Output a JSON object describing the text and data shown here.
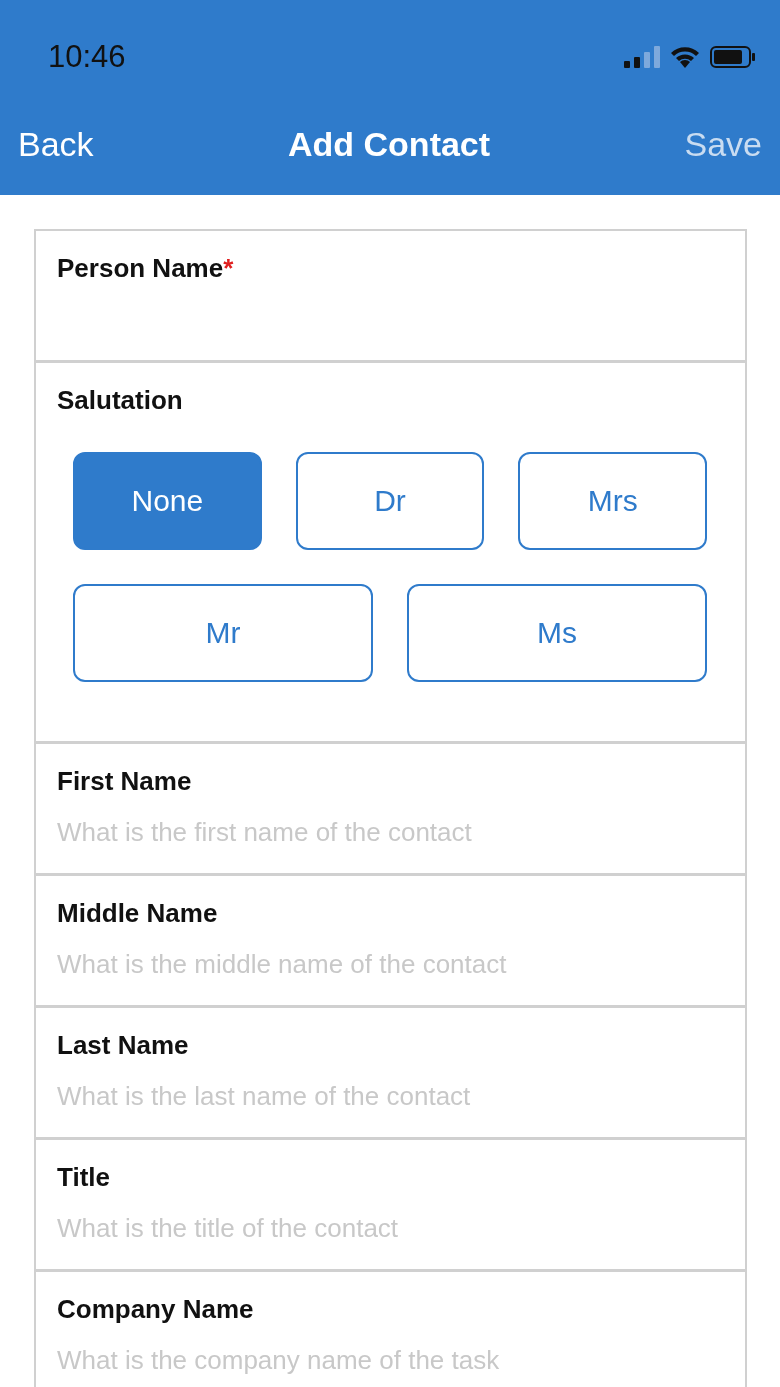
{
  "status_bar": {
    "time": "10:46"
  },
  "nav": {
    "back": "Back",
    "title": "Add Contact",
    "save": {
      "label": "Save",
      "disabled": true
    }
  },
  "form": {
    "person_name": {
      "label": "Person Name",
      "required": true,
      "required_mark": "*"
    },
    "salutation": {
      "label": "Salutation",
      "options": [
        {
          "label": "None",
          "selected": true
        },
        {
          "label": "Dr",
          "selected": false
        },
        {
          "label": "Mrs",
          "selected": false
        },
        {
          "label": "Mr",
          "selected": false
        },
        {
          "label": "Ms",
          "selected": false
        }
      ]
    },
    "fields": [
      {
        "label": "First Name",
        "placeholder": "What is the first name of the contact"
      },
      {
        "label": "Middle Name",
        "placeholder": "What is the middle name of the contact"
      },
      {
        "label": "Last Name",
        "placeholder": "What is the last name of the contact"
      },
      {
        "label": "Title",
        "placeholder": "What is the title of the contact"
      },
      {
        "label": "Company Name",
        "placeholder": "What is the company name of the task"
      }
    ]
  }
}
